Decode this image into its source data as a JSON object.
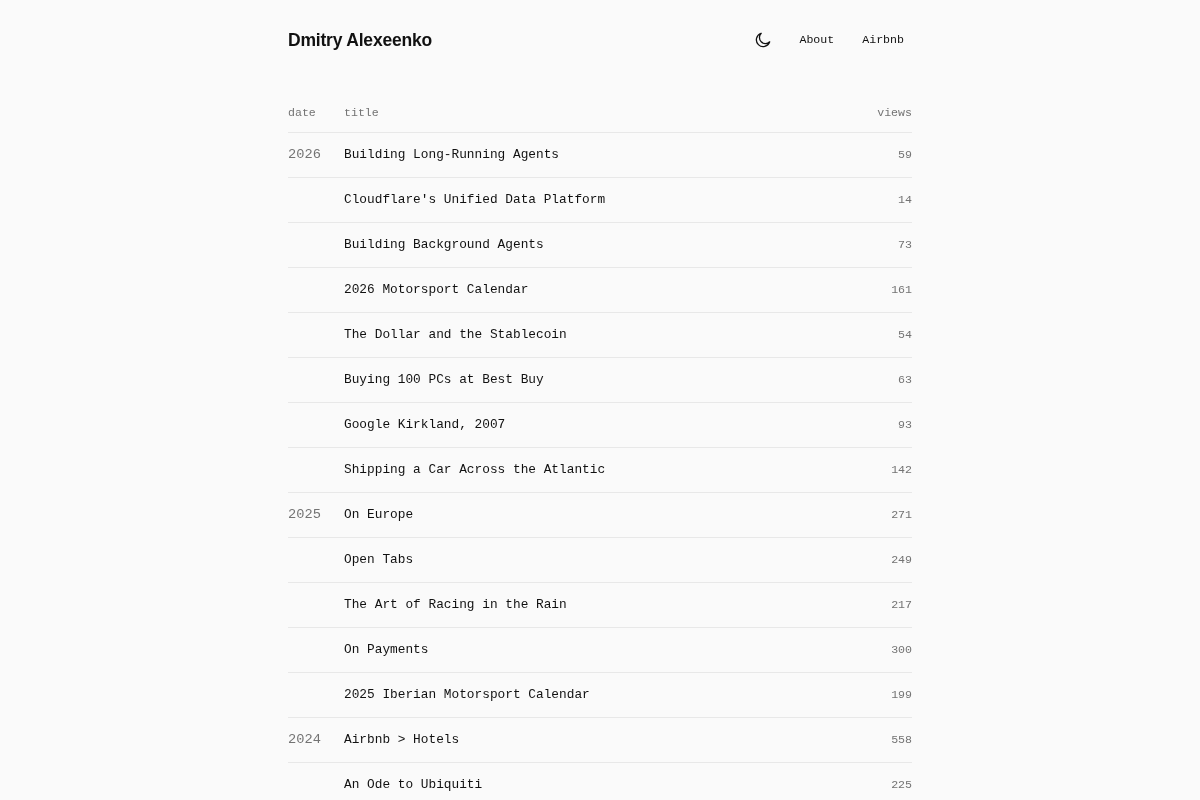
{
  "header": {
    "title": "Dmitry Alexeenko",
    "nav": [
      {
        "label": "About"
      },
      {
        "label": "Airbnb"
      }
    ]
  },
  "table": {
    "columns": [
      "date",
      "title",
      "views"
    ],
    "rows": [
      {
        "date": "2026",
        "title": "Building Long-Running Agents",
        "views": "59"
      },
      {
        "title": "Cloudflare's Unified Data Platform",
        "views": "14"
      },
      {
        "title": "Building Background Agents",
        "views": "73"
      },
      {
        "title": "2026 Motorsport Calendar",
        "views": "161"
      },
      {
        "title": "The Dollar and the Stablecoin",
        "views": "54"
      },
      {
        "title": "Buying 100 PCs at Best Buy",
        "views": "63"
      },
      {
        "title": "Google Kirkland, 2007",
        "views": "93"
      },
      {
        "title": "Shipping a Car Across the Atlantic",
        "views": "142"
      },
      {
        "date": "2025",
        "title": "On Europe",
        "views": "271"
      },
      {
        "title": "Open Tabs",
        "views": "249"
      },
      {
        "title": "The Art of Racing in the Rain",
        "views": "217"
      },
      {
        "title": "On Payments",
        "views": "300"
      },
      {
        "title": "2025 Iberian Motorsport Calendar",
        "views": "199"
      },
      {
        "date": "2024",
        "title": "Airbnb > Hotels",
        "views": "558"
      },
      {
        "title": "An Ode to Ubiquiti",
        "views": "225"
      }
    ]
  }
}
